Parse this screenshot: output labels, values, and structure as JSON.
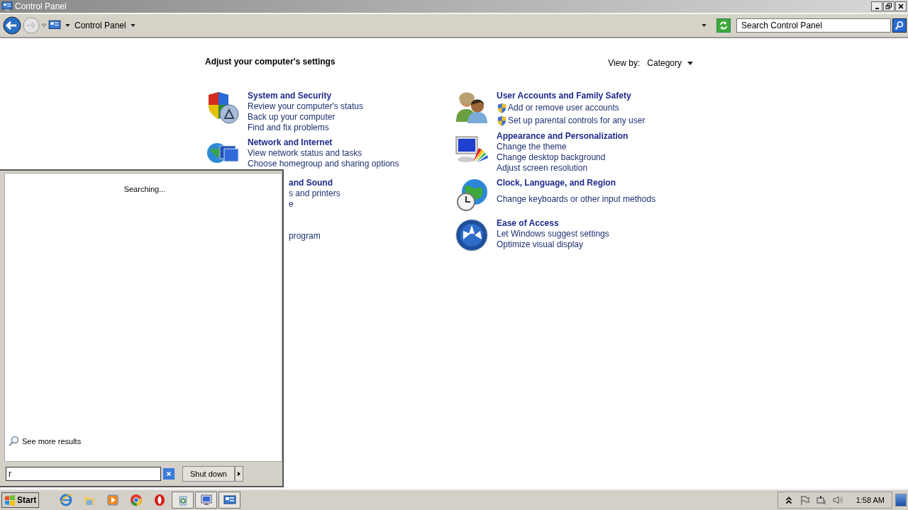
{
  "window": {
    "title": "Control Panel"
  },
  "address_bar": {
    "path": "Control Panel"
  },
  "search": {
    "placeholder": "Search Control Panel"
  },
  "heading": "Adjust your computer's settings",
  "view_by": {
    "label": "View by:",
    "value": "Category"
  },
  "left_categories": [
    {
      "kind": "shield",
      "title": "System and Security",
      "clipped": false,
      "links": [
        {
          "text": "Review your computer's status",
          "shield": false
        },
        {
          "text": "Back up your computer",
          "shield": false
        },
        {
          "text": "Find and fix problems",
          "shield": false
        }
      ]
    },
    {
      "kind": "network",
      "title": "Network and Internet",
      "clipped": false,
      "links": [
        {
          "text": "View network status and tasks",
          "shield": false
        },
        {
          "text": "Choose homegroup and sharing options",
          "shield": false
        }
      ]
    },
    {
      "kind": "hidden",
      "title": "and Sound",
      "clipped": true,
      "links": [
        {
          "text": "s and printers",
          "shield": false
        },
        {
          "text": "e",
          "shield": false
        }
      ]
    },
    {
      "kind": "hidden",
      "clipped": true,
      "links": [
        {
          "text": "program",
          "shield": false
        }
      ]
    }
  ],
  "right_categories": [
    {
      "kind": "users",
      "title": "User Accounts and Family Safety",
      "clipped": false,
      "links": [
        {
          "text": "Add or remove user accounts",
          "shield": true
        },
        {
          "text": "Set up parental controls for any user",
          "shield": true
        }
      ]
    },
    {
      "kind": "display",
      "title": "Appearance and Personalization",
      "clipped": false,
      "links": [
        {
          "text": "Change the theme",
          "shield": false
        },
        {
          "text": "Change desktop background",
          "shield": false
        },
        {
          "text": "Adjust screen resolution",
          "shield": false
        }
      ]
    },
    {
      "kind": "globe",
      "title": "Clock, Language, and Region",
      "clipped": false,
      "links": [
        {
          "text": "Change keyboards or other input methods",
          "shield": false
        }
      ]
    },
    {
      "kind": "access",
      "title": "Ease of Access",
      "clipped": false,
      "links": [
        {
          "text": "Let Windows suggest settings",
          "shield": false
        },
        {
          "text": "Optimize visual display",
          "shield": false
        }
      ]
    }
  ],
  "start_menu": {
    "status": "Searching...",
    "more_results": "See more results",
    "search_value": "r",
    "shutdown": "Shut down"
  },
  "taskbar": {
    "start": "Start",
    "apps": [
      {
        "kind": "ie",
        "open": false
      },
      {
        "kind": "folder",
        "open": false
      },
      {
        "kind": "media",
        "open": false
      },
      {
        "kind": "chrome",
        "open": false
      },
      {
        "kind": "opera",
        "open": false
      },
      {
        "kind": "recycle",
        "open": true
      },
      {
        "kind": "monitor",
        "open": true
      },
      {
        "kind": "panel",
        "open": true
      }
    ],
    "clock": "1:58 AM"
  }
}
